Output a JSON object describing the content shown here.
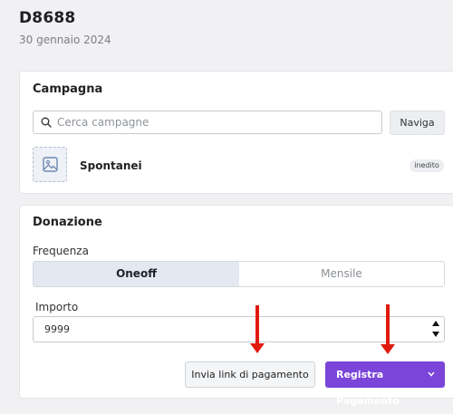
{
  "header": {
    "order_id": "D8688",
    "date": "30 gennaio 2024"
  },
  "campaign": {
    "title": "Campagna",
    "search_placeholder": "Cerca campagne",
    "search_value": "",
    "navigate_button": "Naviga",
    "selected": {
      "name": "Spontanei",
      "status": "inedito",
      "thumbnail_icon": "image-placeholder-icon"
    }
  },
  "donation": {
    "title": "Donazione",
    "frequency_label": "Frequenza",
    "frequency_options": [
      "Oneoff",
      "Mensile"
    ],
    "frequency_selected": "Oneoff",
    "amount_label": "Importo",
    "amount_value": "9999",
    "send_link_button": "Invia link di pagamento",
    "register_button": "Registra Pagamento",
    "accent_color": "#7a45d8"
  },
  "annotations": {
    "arrow_color": "#e11a10"
  }
}
